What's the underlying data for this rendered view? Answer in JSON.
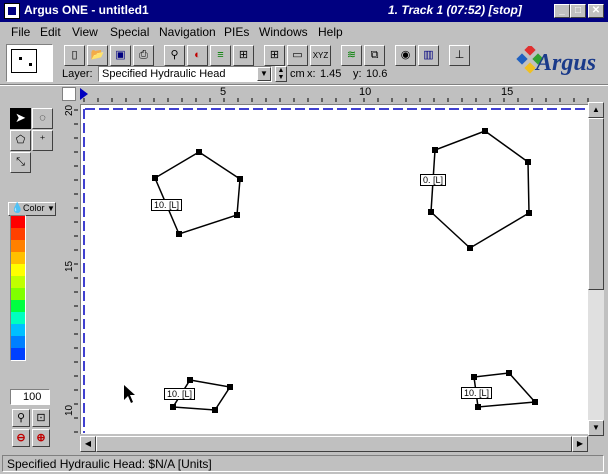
{
  "window": {
    "title": "Argus ONE - untitled1",
    "track": "1. Track 1 (07:52)  [stop]",
    "min": "_",
    "max": "□",
    "close": "✕"
  },
  "menu": [
    "File",
    "Edit",
    "View",
    "Special",
    "Navigation",
    "PIEs",
    "Windows",
    "Help"
  ],
  "toolbar": {
    "layer_label": "Layer:",
    "layer_value": "Specified Hydraulic Head",
    "units": "cm",
    "x_label": "x:",
    "x_value": "1.45",
    "y_label": "y:",
    "y_value": "10.6",
    "logo": "Argus"
  },
  "palette": {
    "color_label": "Color",
    "zoom_value": "100",
    "colors": [
      "#ff0000",
      "#ff4000",
      "#ff8000",
      "#ffc000",
      "#ffff00",
      "#c0ff00",
      "#80ff00",
      "#00ff40",
      "#00ffc0",
      "#00c0ff",
      "#0080ff",
      "#0040ff"
    ]
  },
  "ruler": {
    "x_ticks": [
      "5",
      "10",
      "15"
    ],
    "y_ticks": [
      "20",
      "15",
      "10"
    ]
  },
  "canvas": {
    "labels": [
      "10. [L]",
      "0. [L]",
      "10. [L]",
      "10. [L]"
    ]
  },
  "status": "Specified Hydraulic Head: $N/A [Units]"
}
